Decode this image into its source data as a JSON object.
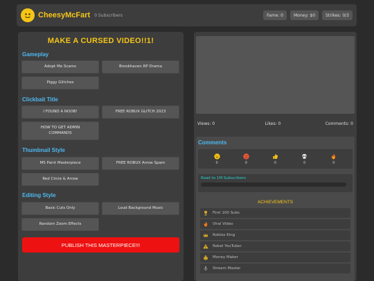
{
  "header": {
    "username": "CheesyMcFart",
    "subscribers": "0 Subscribers",
    "stats": [
      "Fame: 0",
      "Money: $0",
      "Strikes: 0/3"
    ]
  },
  "left": {
    "title": "MAKE A CURSED VIDEO!!1!",
    "sections": [
      {
        "title": "Gameplay",
        "options": [
          "Adopt Me Scams",
          "Brookhaven RP Drama",
          "Piggy Glitches"
        ]
      },
      {
        "title": "Clickbait Title",
        "options": [
          "I FOUND A NOOB!",
          "FREE ROBUX GLITCH 2023",
          "HOW TO GET ADMIN COMMANDS"
        ]
      },
      {
        "title": "Thumbnail Style",
        "options": [
          "MS Paint Masterpiece",
          "FREE ROBUX Arrow Spam",
          "Red Circle & Arrow"
        ]
      },
      {
        "title": "Editing Style",
        "options": [
          "Basic Cuts Only",
          "Loud Background Music",
          "Random Zoom Effects"
        ]
      }
    ],
    "publish": "PUBLISH THIS MASTERPIECE!!!"
  },
  "right": {
    "views": "Views: 0",
    "likes": "Likes: 0",
    "comments": "Comments: 0",
    "comments_title": "Comments",
    "reactions": [
      {
        "icon": "laughing-face-icon",
        "count": "0",
        "color": "#f5c518"
      },
      {
        "icon": "angry-face-icon",
        "count": "0",
        "color": "#ef5b3c"
      },
      {
        "icon": "thumbs-up-icon",
        "count": "0",
        "color": "#f5c518"
      },
      {
        "icon": "skull-icon",
        "count": "0",
        "color": "#e8e8e8"
      },
      {
        "icon": "fire-icon",
        "count": "0",
        "color": "#f07a1a"
      }
    ],
    "road_label": "Road to 1M Subscribers",
    "road_progress": 0,
    "achievements_title": "ACHIEVEMENTS",
    "achievements": [
      {
        "icon": "trophy-icon",
        "label": "First 100 Subs",
        "color": "#c9a227"
      },
      {
        "icon": "fire-icon",
        "label": "Viral Video",
        "color": "#f07a1a"
      },
      {
        "icon": "crown-icon",
        "label": "Roblox King",
        "color": "#c9a227"
      },
      {
        "icon": "warning-icon",
        "label": "Rebel YouTuber",
        "color": "#e0b020"
      },
      {
        "icon": "money-bag-icon",
        "label": "Money Maker",
        "color": "#c9a227"
      },
      {
        "icon": "microphone-icon",
        "label": "Stream Master",
        "color": "#888888"
      }
    ]
  }
}
